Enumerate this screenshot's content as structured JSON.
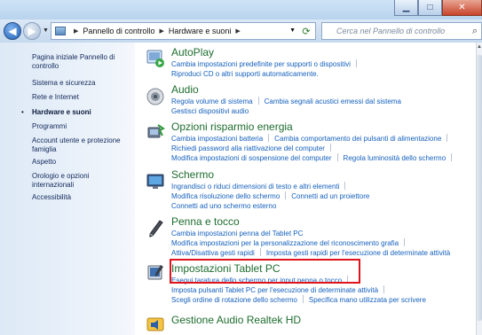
{
  "window": {
    "buttons": [
      "minimize",
      "maximize",
      "close"
    ]
  },
  "nav": {
    "back_label": "◀",
    "forward_label": "▶",
    "breadcrumb": [
      "Pannello di controllo",
      "Hardware e suoni"
    ],
    "search_placeholder": "Cerca nel Pannello di controllo"
  },
  "sidebar": {
    "items": [
      {
        "label": "Pagina iniziale Pannello di controllo"
      },
      {
        "label": "Sistema e sicurezza"
      },
      {
        "label": "Rete e Internet"
      },
      {
        "label": "Hardware e suoni",
        "current": true
      },
      {
        "label": "Programmi"
      },
      {
        "label": "Account utente e protezione famiglia"
      },
      {
        "label": "Aspetto"
      },
      {
        "label": "Orologio e opzioni internazionali"
      },
      {
        "label": "Accessibilità"
      }
    ]
  },
  "categories": [
    {
      "title": "AutoPlay",
      "icon": "autoplay-icon",
      "lines": [
        [
          "Cambia impostazioni predefinite per supporti o dispositivi"
        ],
        [
          "Riproduci CD o altri supporti automaticamente."
        ]
      ]
    },
    {
      "title": "Audio",
      "icon": "speaker-icon",
      "lines": [
        [
          "Regola volume di sistema",
          "Cambia segnali acustici emessi dal sistema"
        ],
        [
          "Gestisci dispositivi audio"
        ]
      ]
    },
    {
      "title": "Opzioni risparmio energia",
      "icon": "power-options-icon",
      "lines": [
        [
          "Cambia impostazioni batteria",
          "Cambia comportamento dei pulsanti di alimentazione"
        ],
        [
          "Richiedi password alla riattivazione del computer"
        ],
        [
          "Modifica impostazioni di sospensione del computer",
          "Regola luminosità dello schermo"
        ]
      ]
    },
    {
      "title": "Schermo",
      "icon": "display-icon",
      "lines": [
        [
          "Ingrandisci o riduci dimensioni di testo e altri elementi"
        ],
        [
          "Modifica risoluzione dello schermo",
          "Connetti ad un proiettore"
        ],
        [
          "Connetti ad uno schermo esterno"
        ]
      ]
    },
    {
      "title": "Penna e tocco",
      "icon": "pen-icon",
      "lines": [
        [
          "Cambia impostazioni penna del Tablet PC"
        ],
        [
          "Modifica impostazioni per la personalizzazione del riconoscimento grafia"
        ],
        [
          "Attiva/Disattiva gesti rapidi",
          "Imposta gesti rapidi per l'esecuzione di determinate attività"
        ]
      ]
    },
    {
      "title": "Impostazioni Tablet PC",
      "icon": "tablet-pc-icon",
      "lines": [
        [
          "Esegui taratura dello schermo per input penna o tocco"
        ],
        [
          "Imposta pulsanti Tablet PC per l'esecuzione di determinate attività"
        ],
        [
          "Scegli ordine di rotazione dello schermo",
          "Specifica mano utilizzata per scrivere"
        ]
      ]
    },
    {
      "title": "Gestione Audio Realtek HD",
      "icon": "realtek-audio-icon",
      "lines": []
    }
  ],
  "colors": {
    "category_title": "#1e6d2f",
    "link": "#1560bd",
    "highlight": "#e0141c"
  }
}
